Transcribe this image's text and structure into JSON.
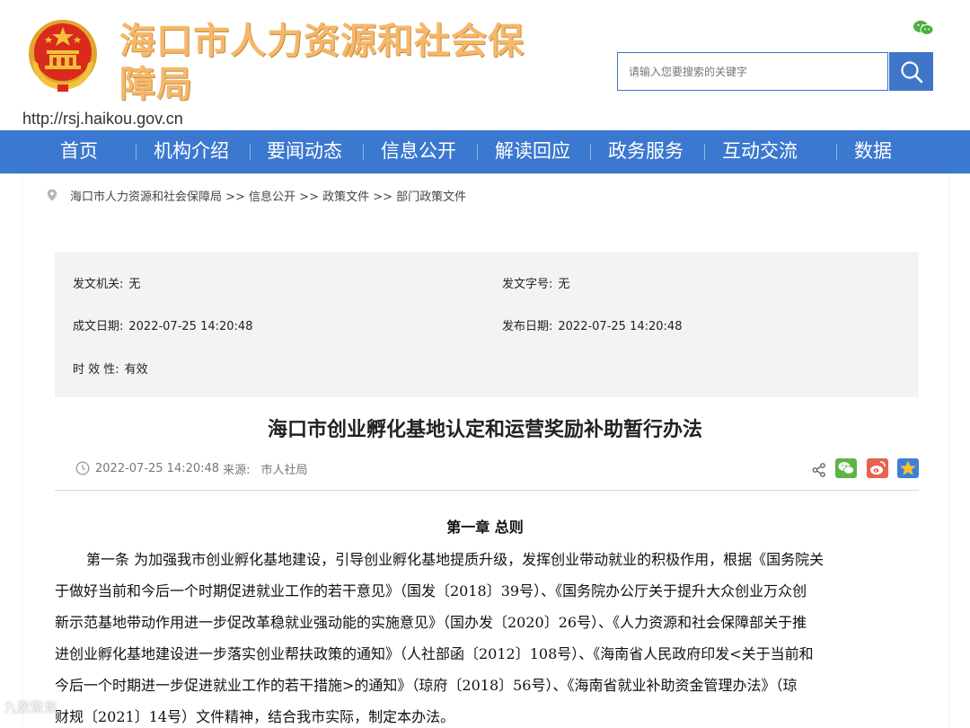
{
  "header": {
    "site_title": "海口市人力资源和社会保障局",
    "url": "http://rsj.haikou.gov.cn",
    "search_placeholder": "请输入您要搜索的关键字",
    "colors": {
      "title": "#f5b86a",
      "accent": "#3b78cf",
      "emblem_red": "#d92a1c",
      "emblem_gold": "#f2c23a"
    }
  },
  "nav": {
    "items": [
      "首页",
      "机构介绍",
      "要闻动态",
      "信息公开",
      "解读回应",
      "政务服务",
      "互动交流",
      "数据"
    ]
  },
  "breadcrumb": {
    "text": "海口市人力资源和社会保障局 >> 信息公开 >> 政策文件 >> 部门政策文件"
  },
  "meta": {
    "issuer_label": "发文机关:",
    "issuer_value": "无",
    "doc_no_label": "发文字号:",
    "doc_no_value": "无",
    "created_label": "成文日期:",
    "created_value": "2022-07-25 14:20:48",
    "published_label": "发布日期:",
    "published_value": "2022-07-25 14:20:48",
    "validity_label": "时 效 性:",
    "validity_value": "有效"
  },
  "article": {
    "title": "海口市创业孵化基地认定和运营奖励补助暂行办法",
    "datetime": "2022-07-25 14:20:48",
    "source_label": "来源:",
    "source": "市人社局",
    "chapter": "第一章  总则",
    "lines": [
      "第一条  为加强我市创业孵化基地建设，引导创业孵化基地提质升级，发挥创业带动就业的积极作用，根据《国务院关",
      "于做好当前和今后一个时期促进就业工作的若干意见》（国发〔2018〕39号）、《国务院办公厅关于提升大众创业万众创",
      "新示范基地带动作用进一步促改革稳就业强动能的实施意见》（国办发〔2020〕26号）、《人力资源和社会保障部关于推",
      "进创业孵化基地建设进一步落实创业帮扶政策的通知》（人社部函〔2012〕108号）、《海南省人民政府印发<关于当前和",
      "今后一个时期进一步促进就业工作的若干措施>的通知》（琼府〔2018〕56号）、《海南省就业补助资金管理办法》（琼",
      "财规〔2021〕14号）文件精神，结合我市实际，制定本办法。"
    ]
  },
  "share_icons": [
    "share-icon",
    "wechat-icon",
    "weibo-icon",
    "qzone-icon"
  ],
  "watermark": "九数聚焦"
}
